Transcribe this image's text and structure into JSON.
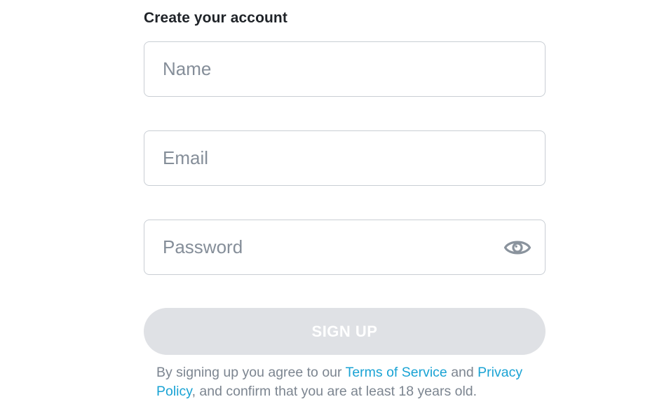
{
  "form": {
    "heading": "Create your account",
    "name_field": {
      "placeholder": "Name",
      "value": ""
    },
    "email_field": {
      "placeholder": "Email",
      "value": ""
    },
    "password_field": {
      "placeholder": "Password",
      "value": "",
      "toggle_icon": "eye-icon"
    },
    "signup_button": {
      "label": "SIGN UP",
      "enabled": false
    },
    "legal": {
      "prefix": "By signing up you agree to our ",
      "terms_link": "Terms of Service",
      "middle": " and ",
      "privacy_link": "Privacy Policy",
      "suffix": ", and confirm that you are at least 18 years old."
    }
  },
  "colors": {
    "heading_text": "#1f2328",
    "field_border": "#c9ced4",
    "placeholder_text": "#858e99",
    "icon_gray": "#8a939d",
    "button_disabled_bg": "#dfe1e5",
    "button_disabled_text": "#ffffff",
    "legal_text": "#7c8590",
    "link": "#1aa3d4"
  }
}
